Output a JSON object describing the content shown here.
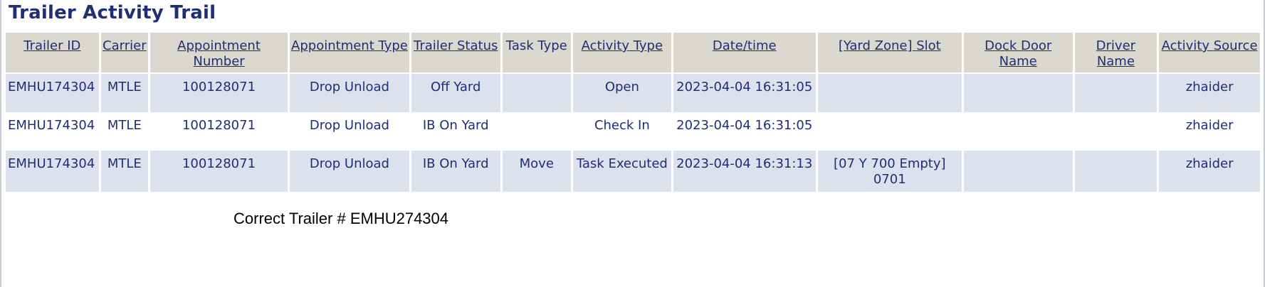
{
  "page": {
    "title": "Trailer Activity Trail",
    "note": "Correct Trailer # EMHU274304"
  },
  "table": {
    "headers": [
      {
        "key": "trailer_id",
        "label": "Trailer ID"
      },
      {
        "key": "carrier",
        "label": "Carrier"
      },
      {
        "key": "appointment_number",
        "label": "Appointment Number"
      },
      {
        "key": "appointment_type",
        "label": "Appointment Type"
      },
      {
        "key": "trailer_status",
        "label": "Trailer Status"
      },
      {
        "key": "task_type",
        "label": "Task Type"
      },
      {
        "key": "activity_type",
        "label": "Activity Type"
      },
      {
        "key": "datetime",
        "label": "Date/time"
      },
      {
        "key": "yard_zone_slot",
        "label": "[Yard Zone] Slot"
      },
      {
        "key": "dock_door_name",
        "label": "Dock Door Name"
      },
      {
        "key": "driver_name",
        "label": "Driver Name"
      },
      {
        "key": "activity_source",
        "label": "Activity Source"
      }
    ],
    "rows": [
      {
        "trailer_id": "EMHU174304",
        "carrier": "MTLE",
        "appointment_number": "100128071",
        "appointment_type": "Drop Unload",
        "trailer_status": "Off Yard",
        "task_type": "",
        "activity_type": "Open",
        "datetime": "2023-04-04 16:31:05",
        "yard_zone_slot": "",
        "dock_door_name": "",
        "driver_name": "",
        "activity_source": "zhaider"
      },
      {
        "trailer_id": "EMHU174304",
        "carrier": "MTLE",
        "appointment_number": "100128071",
        "appointment_type": "Drop Unload",
        "trailer_status": "IB On Yard",
        "task_type": "",
        "activity_type": "Check In",
        "datetime": "2023-04-04 16:31:05",
        "yard_zone_slot": "",
        "dock_door_name": "",
        "driver_name": "",
        "activity_source": "zhaider"
      },
      {
        "trailer_id": "EMHU174304",
        "carrier": "MTLE",
        "appointment_number": "100128071",
        "appointment_type": "Drop Unload",
        "trailer_status": "IB On Yard",
        "task_type": "Move",
        "activity_type": "Task Executed",
        "datetime": "2023-04-04 16:31:13",
        "yard_zone_slot": "[07 Y 700 Empty] 0701",
        "dock_door_name": "",
        "driver_name": "",
        "activity_source": "zhaider"
      }
    ]
  }
}
